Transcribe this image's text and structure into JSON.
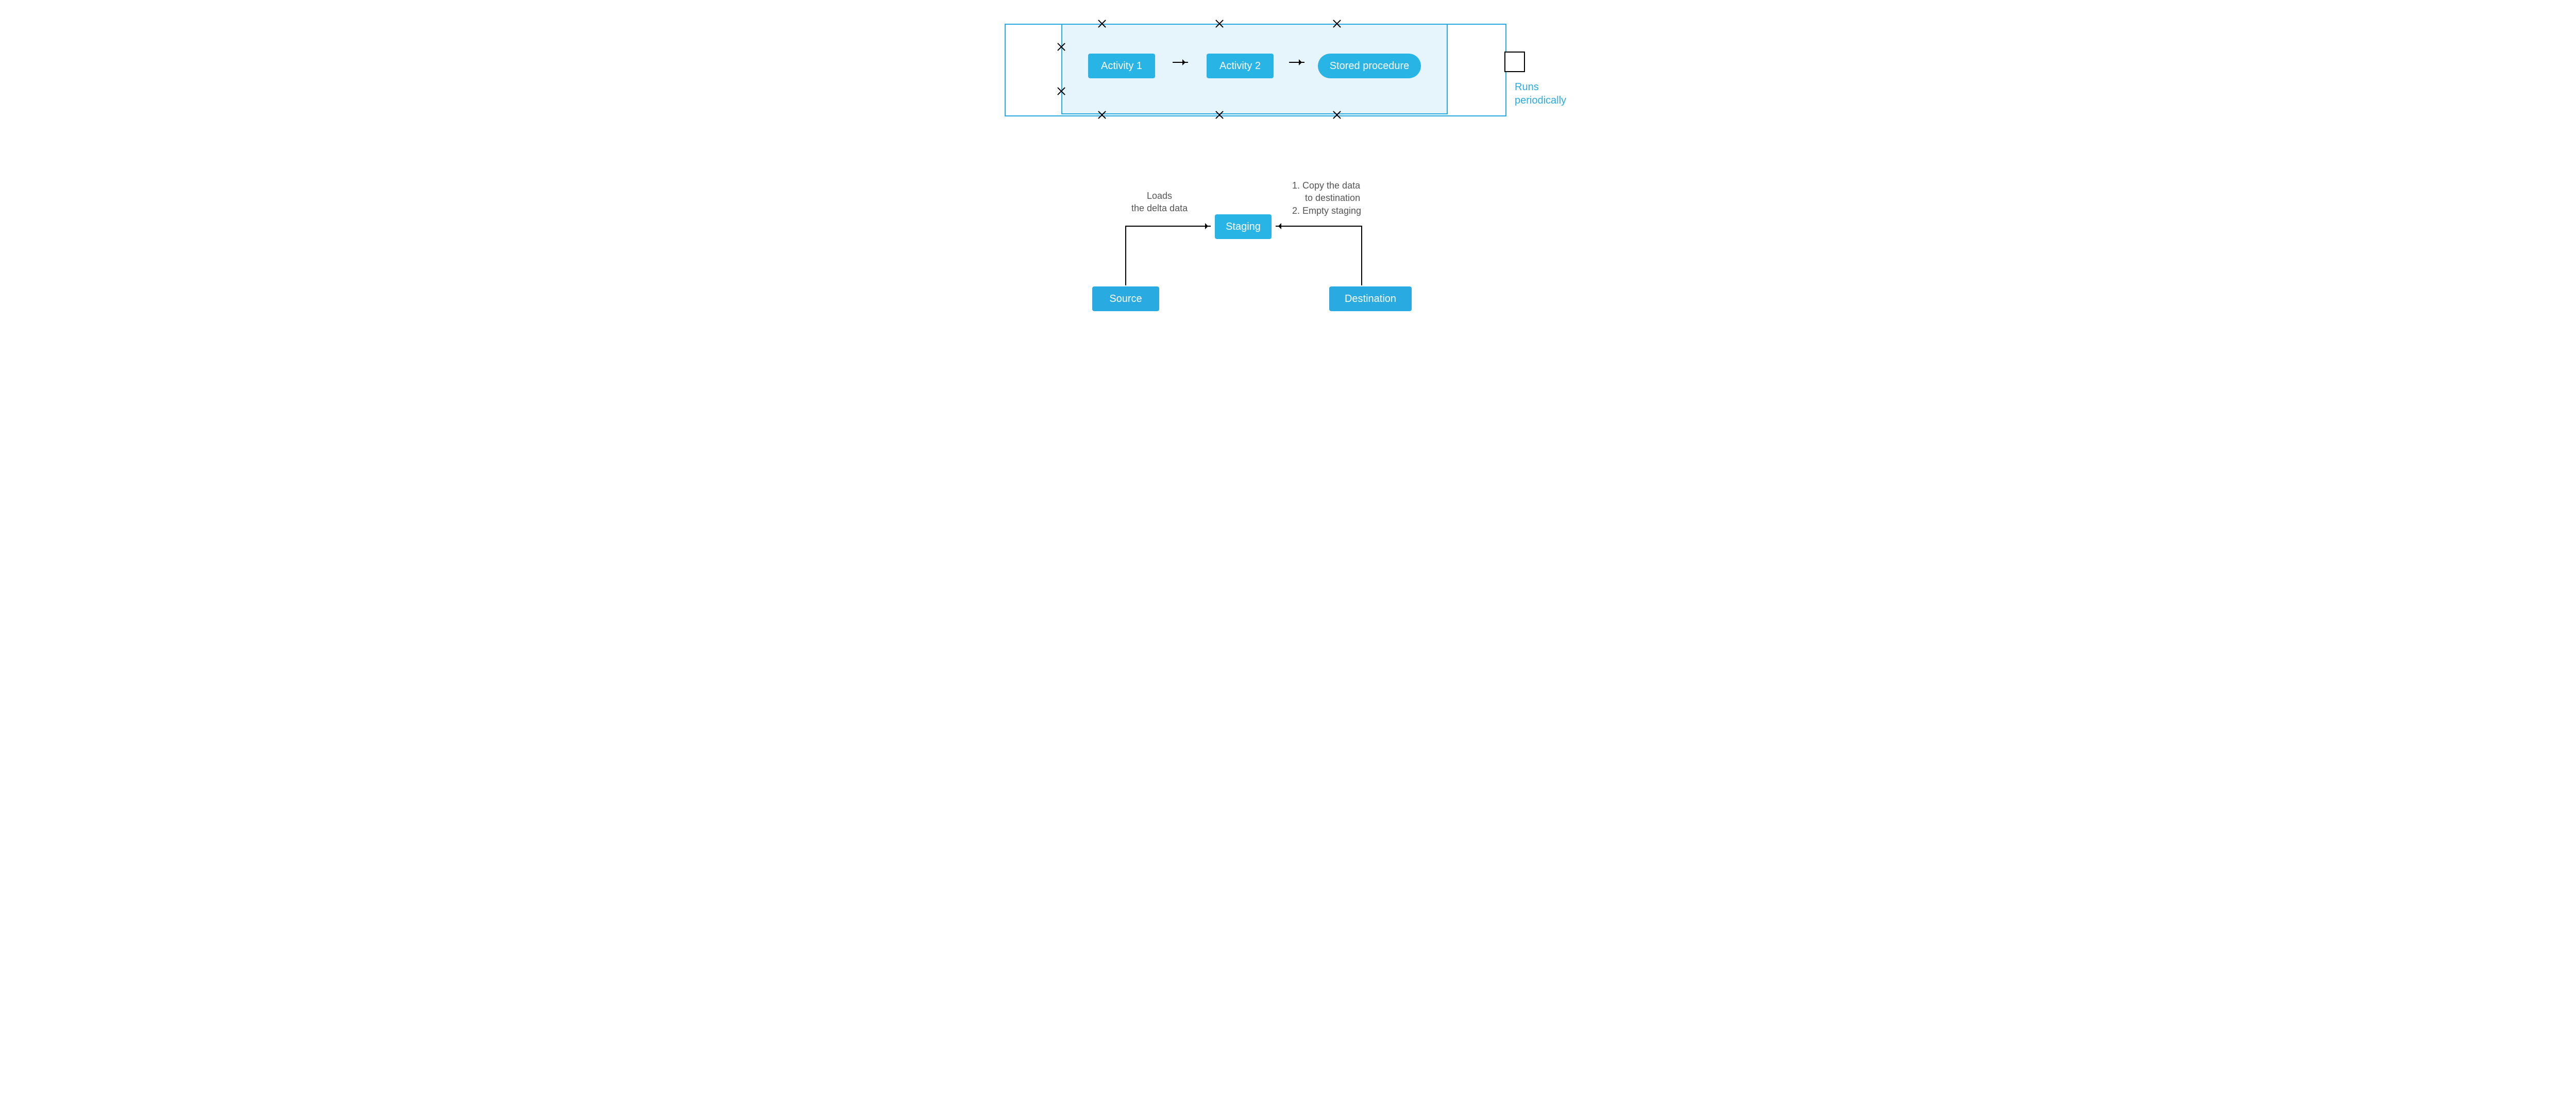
{
  "pipeline": {
    "activity1": "Activity 1",
    "activity2": "Activity 2",
    "stored_procedure": "Stored procedure",
    "runs_label": "Runs\nperiodically"
  },
  "captions": {
    "loads_delta": "Loads\nthe delta data",
    "steps_line1": "1.  Copy the data",
    "steps_line1b": "     to destination",
    "steps_line2": "2.  Empty staging"
  },
  "nodes": {
    "staging": "Staging",
    "source": "Source",
    "destination": "Destination"
  }
}
